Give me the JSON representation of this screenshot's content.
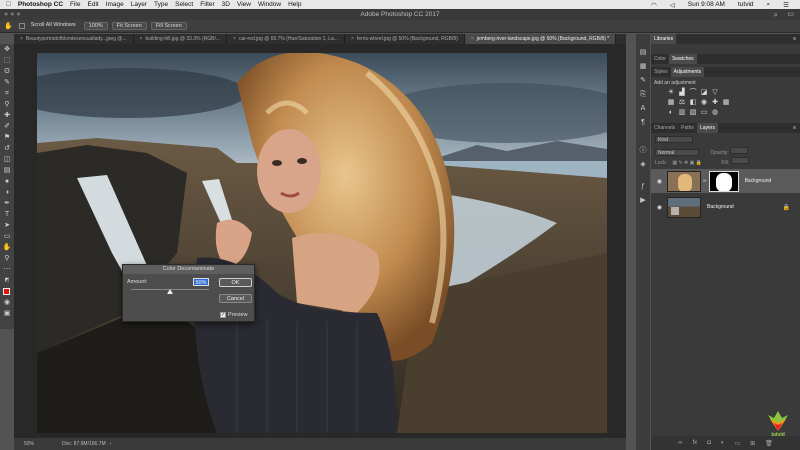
{
  "menubar": {
    "app_name": "Photoshop CC",
    "items": [
      "File",
      "Edit",
      "Image",
      "Layer",
      "Type",
      "Select",
      "Filter",
      "3D",
      "View",
      "Window",
      "Help"
    ],
    "clock": "Sun 9:08 AM",
    "user": "tutvid"
  },
  "title_bar": {
    "title": "Adobe Photoshop CC 2017"
  },
  "options_bar": {
    "buttons": [
      "Scroll All Windows",
      "100%",
      "Fit Screen",
      "Fill Screen"
    ]
  },
  "tabs": [
    {
      "label": "Beautyportraitofblondesensuallady...jpeg @..."
    },
    {
      "label": "building-hill.jpg @ 33.3% (RGB/..."
    },
    {
      "label": "car-red.jpg @ 66.7% (Hue/Saturation 1, La..."
    },
    {
      "label": "ferris-wheel.jpg @ 50% (Background, RGB/8)"
    },
    {
      "label": "jemberg-river-landscape.jpg @ 50% (Background, RGB/8) *"
    }
  ],
  "status_bar": {
    "zoom": "50%",
    "doc": "Doc: 87.9M/166.7M"
  },
  "dialog": {
    "title": "Color Decontaminate",
    "amount_label": "Amount:",
    "amount_value": "50%",
    "amount_fraction": 0.5,
    "ok_label": "OK",
    "cancel_label": "Cancel",
    "preview_label": "Preview",
    "preview_checked": "✓"
  },
  "panels": {
    "libraries_tab": "Libraries",
    "swatch_tabs": [
      "Color",
      "Swatches"
    ],
    "adj_tabs": [
      "Styles",
      "Adjustments"
    ],
    "adj_title": "Add an adjustment",
    "layer_tabs": [
      "Channels",
      "Paths",
      "Layers"
    ],
    "kind_label": "Kind",
    "blend_mode": "Normal",
    "opacity_label": "Opacity:",
    "lock_label": "Lock:",
    "fill_label": "Fill:",
    "layers": [
      {
        "name": "Background",
        "selected": true
      },
      {
        "name": "Background",
        "selected": false
      }
    ]
  },
  "watermark": {
    "label": "tutvid"
  }
}
